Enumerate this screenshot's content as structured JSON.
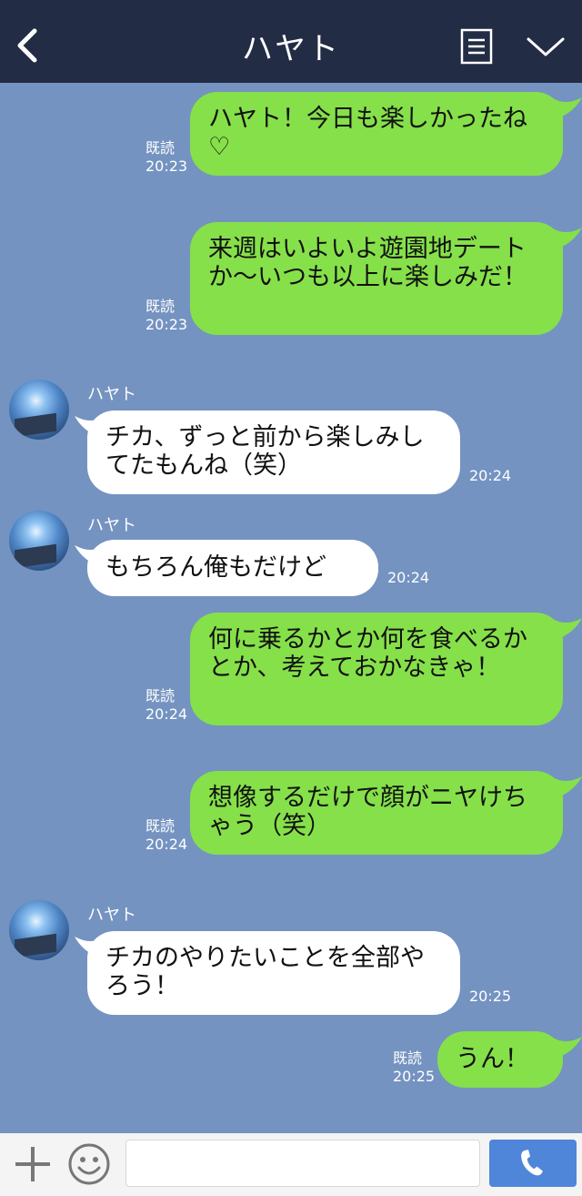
{
  "header": {
    "title": "ハヤト"
  },
  "messages": [
    {
      "side": "me",
      "text": "ハヤト！今日も楽しかったね♡",
      "read": "既読",
      "time": "20:23"
    },
    {
      "side": "me",
      "text": "来週はいよいよ遊園地デートか〜いつも以上に楽しみだ！",
      "read": "既読",
      "time": "20:23"
    },
    {
      "side": "other",
      "name": "ハヤト",
      "text": "チカ、ずっと前から楽しみしてたもんね（笑）",
      "time": "20:24"
    },
    {
      "side": "other",
      "name": "ハヤト",
      "text": "もちろん俺もだけど",
      "time": "20:24"
    },
    {
      "side": "me",
      "text": "何に乗るかとか何を食べるかとか、考えておかなきゃ！",
      "read": "既読",
      "time": "20:24"
    },
    {
      "side": "me",
      "text": "想像するだけで顔がニヤけちゃう（笑）",
      "read": "既読",
      "time": "20:24"
    },
    {
      "side": "other",
      "name": "ハヤト",
      "text": "チカのやりたいことを全部やろう！",
      "time": "20:25"
    },
    {
      "side": "me",
      "text": "うん！",
      "read": "既読",
      "time": "20:25"
    }
  ],
  "footer": {
    "input_placeholder": ""
  },
  "icons": {
    "back": "chevron-left-icon",
    "menu": "menu-icon",
    "collapse": "chevron-down-icon",
    "add": "plus-icon",
    "emoji": "smile-icon",
    "call": "phone-icon"
  },
  "colors": {
    "header_bg": "#222c45",
    "chat_bg": "#7493c1",
    "my_bubble": "#86e04a",
    "other_bubble": "#ffffff",
    "call_button": "#4f86d9"
  }
}
